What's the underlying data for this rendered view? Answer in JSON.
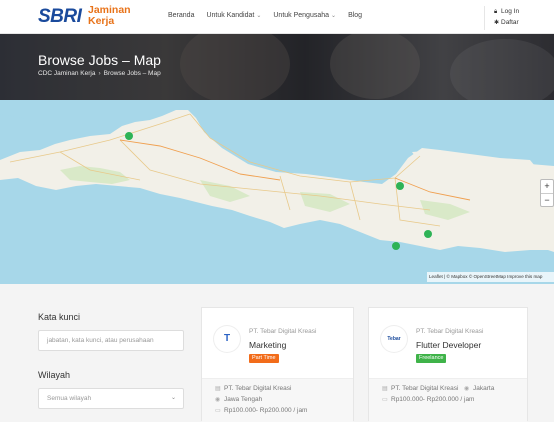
{
  "header": {
    "logo": {
      "brand": "SBRI",
      "line1": "Jaminan",
      "line2": "Kerja"
    },
    "nav": [
      {
        "label": "Beranda",
        "has_dropdown": false
      },
      {
        "label": "Untuk Kandidat",
        "has_dropdown": true
      },
      {
        "label": "Untuk Pengusaha",
        "has_dropdown": true
      },
      {
        "label": "Blog",
        "has_dropdown": false
      }
    ],
    "login": "Log In",
    "register": "Daftar"
  },
  "hero": {
    "title": "Browse Jobs – Map",
    "breadcrumb": [
      "CDC Jaminan Kerja",
      "Browse Jobs – Map"
    ]
  },
  "map": {
    "zoom_in": "+",
    "zoom_out": "−",
    "attribution": "Leaflet | © Mapbox © OpenStreetMap Improve this map",
    "marker_color": "#2eb356"
  },
  "filters": {
    "keyword_label": "Kata kunci",
    "keyword_placeholder": "jabatan, kata kunci, atau perusahaan",
    "region_label": "Wilayah",
    "region_value": "Semua wilayah"
  },
  "jobs": [
    {
      "company": "PT. Tebar Digital Kreasi",
      "title": "Marketing",
      "type": "Part Time",
      "type_color": "#f26c1a",
      "company_footer": "PT. Tebar Digital Kreasi",
      "location": "Jawa Tengah",
      "salary": "Rp100.000- Rp200.000 / jam"
    },
    {
      "company": "PT. Tebar Digital Kreasi",
      "title": "Flutter Developer",
      "type": "Freelance",
      "type_color": "#3fb349",
      "company_footer": "PT. Tebar Digital Kreasi",
      "location": "Jakarta",
      "salary": "Rp100.000- Rp200.000 / jam"
    }
  ]
}
